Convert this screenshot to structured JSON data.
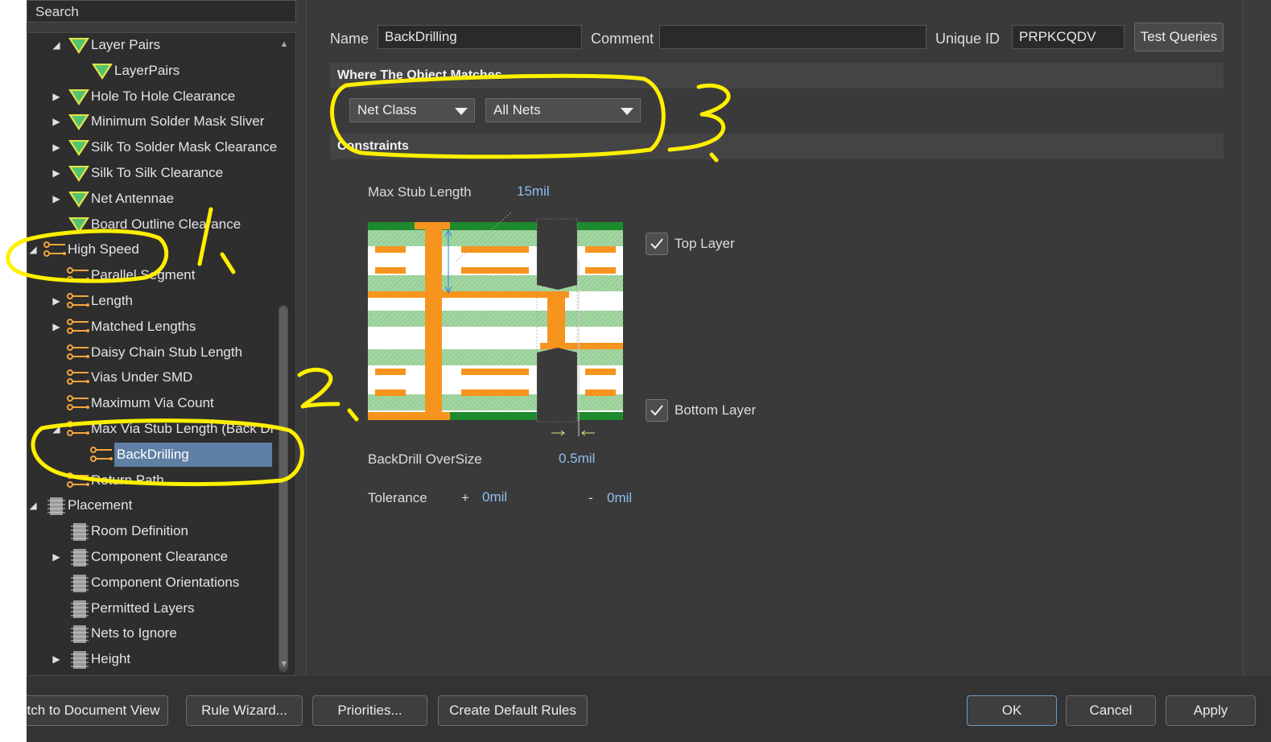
{
  "search": {
    "label": "Search"
  },
  "tree": {
    "items": [
      {
        "label": "Layer Pairs",
        "icon": "rule-icon",
        "expander": "expanded"
      },
      {
        "label": "LayerPairs",
        "icon": "rule-icon",
        "expander": "none"
      },
      {
        "label": "Hole To Hole Clearance",
        "icon": "rule-icon",
        "expander": "collapsed"
      },
      {
        "label": "Minimum Solder Mask Sliver",
        "icon": "rule-icon",
        "expander": "collapsed"
      },
      {
        "label": "Silk To Solder Mask Clearance",
        "icon": "rule-icon",
        "expander": "collapsed"
      },
      {
        "label": "Silk To Silk Clearance",
        "icon": "rule-icon",
        "expander": "collapsed"
      },
      {
        "label": "Net Antennae",
        "icon": "rule-icon",
        "expander": "collapsed"
      },
      {
        "label": "Board Outline Clearance",
        "icon": "rule-icon",
        "expander": "none"
      },
      {
        "label": "High Speed",
        "icon": "high-speed-icon",
        "expander": "expanded"
      },
      {
        "label": "Parallel Segment",
        "icon": "high-speed-icon",
        "expander": "none"
      },
      {
        "label": "Length",
        "icon": "high-speed-icon",
        "expander": "collapsed"
      },
      {
        "label": "Matched Lengths",
        "icon": "high-speed-icon",
        "expander": "collapsed"
      },
      {
        "label": "Daisy Chain Stub Length",
        "icon": "high-speed-icon",
        "expander": "none"
      },
      {
        "label": "Vias Under SMD",
        "icon": "high-speed-icon",
        "expander": "none"
      },
      {
        "label": "Maximum Via Count",
        "icon": "high-speed-icon",
        "expander": "none"
      },
      {
        "label": "Max Via Stub Length (Back Dr",
        "icon": "high-speed-icon",
        "expander": "expanded"
      },
      {
        "label": "BackDrilling",
        "icon": "high-speed-icon",
        "expander": "none",
        "selected": true
      },
      {
        "label": "Return Path",
        "icon": "high-speed-icon",
        "expander": "none"
      },
      {
        "label": "Placement",
        "icon": "placement-icon",
        "expander": "expanded"
      },
      {
        "label": "Room Definition",
        "icon": "placement-icon",
        "expander": "none"
      },
      {
        "label": "Component Clearance",
        "icon": "placement-icon",
        "expander": "collapsed"
      },
      {
        "label": "Component Orientations",
        "icon": "placement-icon",
        "expander": "none"
      },
      {
        "label": "Permitted Layers",
        "icon": "placement-icon",
        "expander": "none"
      },
      {
        "label": "Nets to Ignore",
        "icon": "placement-icon",
        "expander": "none"
      },
      {
        "label": "Height",
        "icon": "placement-icon",
        "expander": "collapsed"
      }
    ]
  },
  "rule": {
    "name_label": "Name",
    "name_value": "BackDrilling",
    "comment_label": "Comment",
    "comment_value": "",
    "uid_label": "Unique ID",
    "uid_value": "PRPKCQDV",
    "test_queries": "Test Queries"
  },
  "where": {
    "title": "Where The Object Matches",
    "scope": "Net Class",
    "target": "All Nets"
  },
  "constraints": {
    "title": "Constraints",
    "max_stub_label": "Max Stub Length",
    "max_stub_value": "15mil",
    "top_layer_label": "Top Layer",
    "top_layer_checked": true,
    "bottom_layer_label": "Bottom Layer",
    "bottom_layer_checked": true,
    "oversize_label": "BackDrill OverSize",
    "oversize_value": "0.5mil",
    "tolerance_label": "Tolerance",
    "tol_plus_sign": "+",
    "tol_plus_value": "0mil",
    "tol_minus_sign": "-",
    "tol_minus_value": "0mil"
  },
  "buttons": {
    "doc_view": "tch to Document View",
    "rule_wizard": "Rule Wizard...",
    "priorities": "Priorities...",
    "create_defaults": "Create Default Rules",
    "ok": "OK",
    "cancel": "Cancel",
    "apply": "Apply"
  },
  "annotations": {
    "mark1": "1.",
    "mark2": "2.",
    "mark3": "3",
    "color": "#ffef00"
  },
  "colors": {
    "selection": "#5f7fa5",
    "value_text": "#8fbef0",
    "copper": "#f7941d",
    "substrate": "#9fd39f"
  }
}
